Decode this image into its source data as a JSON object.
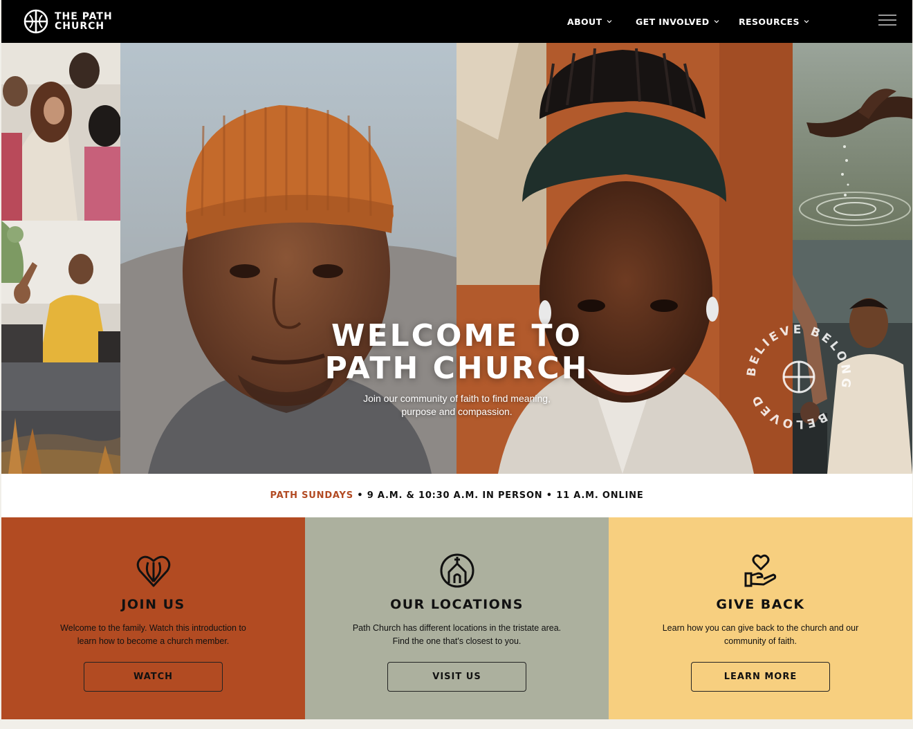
{
  "brand": {
    "line1": "THE PATH",
    "line2": "CHURCH",
    "logo_icon": "path-cross-logo-icon"
  },
  "nav": {
    "items": [
      {
        "label": "ABOUT",
        "icon": "chevron-down-icon"
      },
      {
        "label": "GET INVOLVED",
        "icon": "chevron-down-icon"
      },
      {
        "label": "RESOURCES",
        "icon": "chevron-down-icon"
      }
    ],
    "menu_icon": "hamburger-menu-icon"
  },
  "hero": {
    "title_line1": "WELCOME TO",
    "title_line2": "PATH CHURCH",
    "subtitle_line1": "Join our community of faith to find meaning,",
    "subtitle_line2": "purpose and compassion.",
    "badge_words": [
      "BELIEVE",
      "BELONG",
      "BELOVED"
    ],
    "photos": [
      "worship-crowd-photo",
      "praying-woman-yellow-sweater-photo",
      "autumn-hills-photo",
      "man-orange-beanie-photo",
      "smiling-woman-headwrap-photo",
      "hand-pouring-water-photo",
      "man-praying-choir-photo"
    ]
  },
  "schedule": {
    "highlight": "PATH SUNDAYS",
    "details": " • 9 A.M. & 10:30 A.M. IN PERSON • 11 A.M. ONLINE"
  },
  "cards": [
    {
      "title": "JOIN US",
      "text_line1": "Welcome to the family. Watch this introduction to",
      "text_line2": "learn how to become a church member.",
      "button": "WATCH",
      "icon": "heart-hands-icon",
      "bg": "#b24b22"
    },
    {
      "title": "OUR LOCATIONS",
      "text_line1": "Path Church has different locations in the tristate area.",
      "text_line2": "Find the one that's closest to you.",
      "button": "VISIT US",
      "icon": "church-building-icon",
      "bg": "#acb09e"
    },
    {
      "title": "GIVE BACK",
      "text_line1": "Learn how you can give back to the church and our",
      "text_line2": "community of faith.",
      "button": "LEARN MORE",
      "icon": "hand-heart-icon",
      "bg": "#f7cf7f"
    }
  ],
  "colors": {
    "accent": "#b24a22",
    "nav_bg": "#000000",
    "page_bg": "#f1efe9"
  }
}
